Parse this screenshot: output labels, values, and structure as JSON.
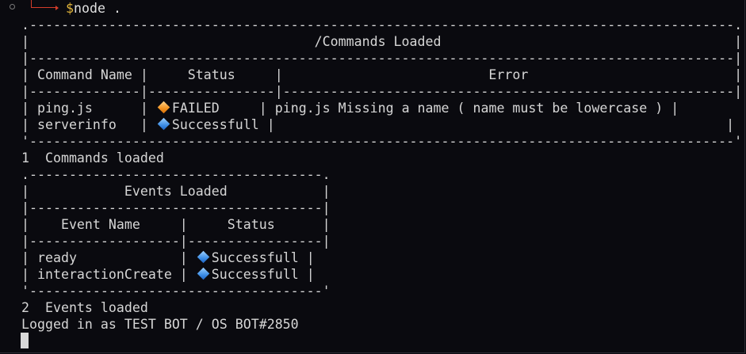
{
  "prompt": {
    "symbol": "$",
    "command": "node ."
  },
  "commands_table": {
    "border_top": ".-----------------------------------------------------------------------------------------.",
    "title_row": "|                                    /Commands Loaded                                     |",
    "sep1": "|-----------------------------------------------------------------------------------------|",
    "header_row": "| Command Name |     Status     |                          Error                          |",
    "sep2": "|--------------|----------------|---------------------------------------------------------|",
    "rows": [
      {
        "prefix": "| ping.js      | ",
        "icon": "orange-diamond-icon",
        "status": "FAILED",
        "suffix": "     | ping.js Missing a name ( name must be lowercase ) |"
      },
      {
        "prefix": "| serverinfo   | ",
        "icon": "blue-diamond-icon",
        "status": "Successfull",
        "suffix": " |                                                         |"
      }
    ],
    "border_bottom": "'-----------------------------------------------------------------------------------------'",
    "summary": "1  Commands loaded"
  },
  "events_table": {
    "border_top": ".-------------------------------------.",
    "title_row": "|            Events Loaded            |",
    "sep1": "|-------------------------------------|",
    "header_row": "|    Event Name     |     Status      |",
    "sep2": "|-------------------|-----------------|",
    "rows": [
      {
        "prefix": "| ready             | ",
        "icon": "blue-diamond-icon",
        "status": "Successfull",
        "suffix": " |"
      },
      {
        "prefix": "| interactionCreate | ",
        "icon": "blue-diamond-icon",
        "status": "Successfull",
        "suffix": " |"
      }
    ],
    "border_bottom": "'-------------------------------------'",
    "summary": "2  Events loaded"
  },
  "login_line": "Logged in as TEST BOT / OS BOT#2850",
  "colors": {
    "background": "#0a0a0f",
    "text": "#d6d6d6",
    "prompt_symbol": "#e2b53a",
    "prompt_arrow": "#d43c2a"
  }
}
